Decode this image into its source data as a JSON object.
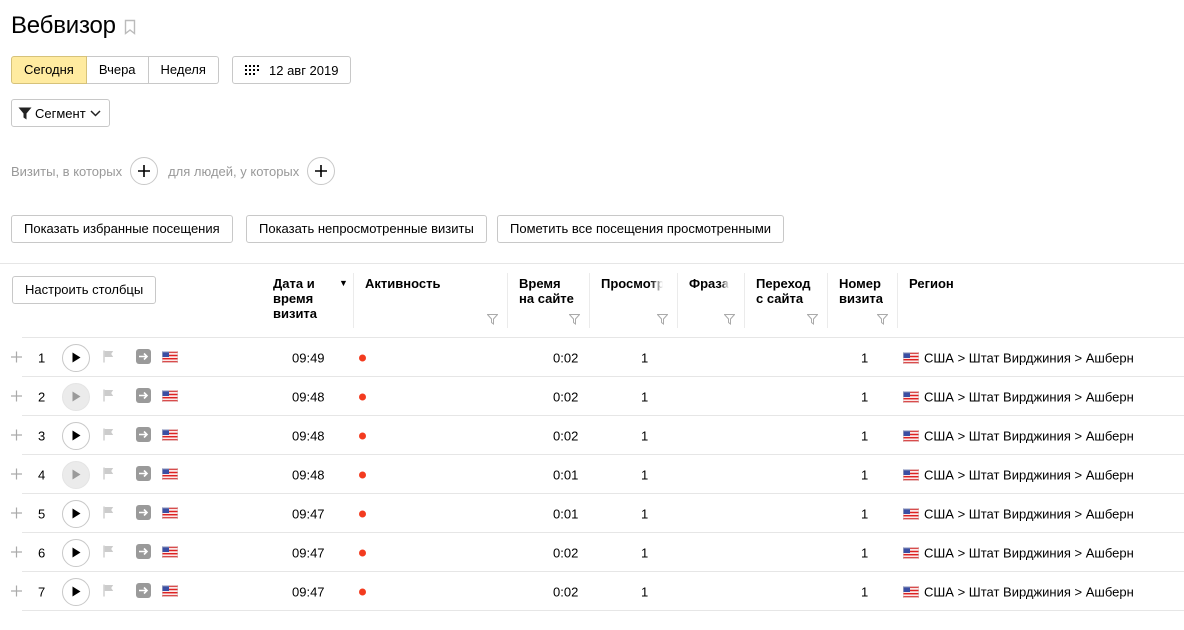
{
  "page": {
    "title": "Вебвизор"
  },
  "period": {
    "buttons": [
      "Сегодня",
      "Вчера",
      "Неделя"
    ],
    "active": "Сегодня"
  },
  "date": {
    "label": "12 авг 2019"
  },
  "segment": {
    "label": "Сегмент"
  },
  "filters": {
    "visits_label": "Визиты, в которых",
    "people_label": "для людей, у которых"
  },
  "actions": {
    "favorites": "Показать избранные посещения",
    "unviewed": "Показать непросмотренные визиты",
    "mark_all": "Пометить все посещения просмотренными"
  },
  "table": {
    "configure_label": "Настроить столбцы",
    "headers": {
      "datetime": "Дата и\nвремя\nвизита",
      "activity": "Активность",
      "duration": "Время\nна сайте",
      "views": "Просмотр",
      "phrase": "Фраза",
      "referrer": "Переход\nс сайта",
      "visit_no": "Номер\nвизита",
      "region": "Регион"
    },
    "rows": [
      {
        "n": "1",
        "time": "09:49",
        "duration": "0:02",
        "views": "1",
        "visit_no": "1",
        "region": "США > Штат Вирджиния > Ашберн",
        "viewed": false
      },
      {
        "n": "2",
        "time": "09:48",
        "duration": "0:02",
        "views": "1",
        "visit_no": "1",
        "region": "США > Штат Вирджиния > Ашберн",
        "viewed": true
      },
      {
        "n": "3",
        "time": "09:48",
        "duration": "0:02",
        "views": "1",
        "visit_no": "1",
        "region": "США > Штат Вирджиния > Ашберн",
        "viewed": false
      },
      {
        "n": "4",
        "time": "09:48",
        "duration": "0:01",
        "views": "1",
        "visit_no": "1",
        "region": "США > Штат Вирджиния > Ашберн",
        "viewed": true
      },
      {
        "n": "5",
        "time": "09:47",
        "duration": "0:01",
        "views": "1",
        "visit_no": "1",
        "region": "США > Штат Вирджиния > Ашберн",
        "viewed": false
      },
      {
        "n": "6",
        "time": "09:47",
        "duration": "0:02",
        "views": "1",
        "visit_no": "1",
        "region": "США > Штат Вирджиния > Ашберн",
        "viewed": false
      },
      {
        "n": "7",
        "time": "09:47",
        "duration": "0:02",
        "views": "1",
        "visit_no": "1",
        "region": "США > Штат Вирджиния > Ашберн",
        "viewed": false
      }
    ]
  },
  "colors": {
    "active_period": "#ffeba0",
    "activity_dot": "#f33b1f",
    "border": "#c8c8c8"
  }
}
